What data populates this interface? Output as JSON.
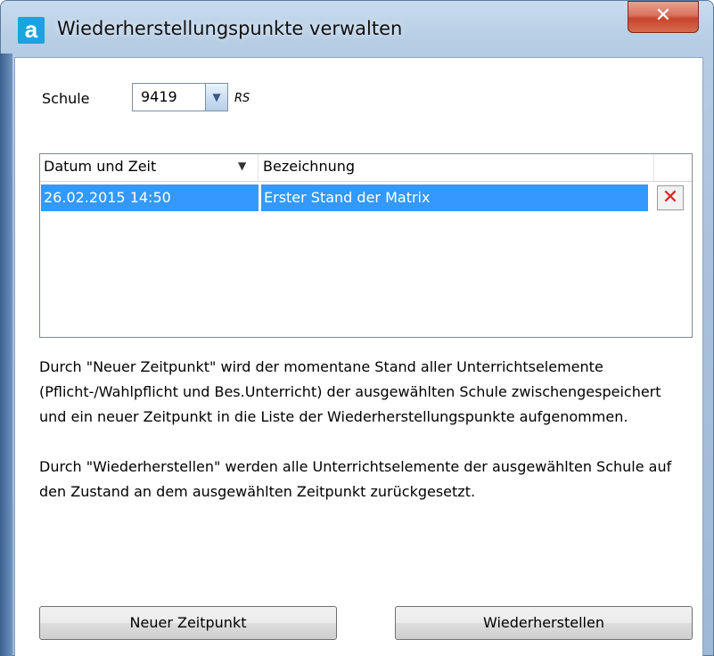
{
  "window": {
    "title": "Wiederherstellungspunkte verwalten",
    "app_icon_letter": "a",
    "close_glyph": "✕"
  },
  "school": {
    "label": "Schule",
    "value": "9419",
    "type_label": "RS"
  },
  "list": {
    "columns": [
      "Datum und Zeit",
      "Bezeichnung"
    ],
    "sort_indicator": "▼",
    "rows": [
      {
        "date": "26.02.2015 14:50",
        "name": "Erster Stand der Matrix",
        "selected": true
      }
    ]
  },
  "description": {
    "paragraph1": "Durch \"Neuer Zeitpunkt\" wird der momentane Stand aller Unterrichtselemente (Pflicht-/Wahlpflicht und Bes.Unterricht) der ausgewählten Schule zwischengespeichert und ein neuer Zeitpunkt in die Liste der Wiederherstellungspunkte aufgenommen.",
    "paragraph2": "Durch \"Wiederherstellen\" werden alle Unterrichtselemente der ausgewählten Schule auf den Zustand an dem ausgewählten Zeitpunkt zurückgesetzt."
  },
  "buttons": {
    "new_point": "Neuer Zeitpunkt",
    "restore": "Wiederherstellen"
  },
  "colors": {
    "selection": "#3399ff",
    "close_button": "#c8452c",
    "frame": "#a9c1dc"
  }
}
